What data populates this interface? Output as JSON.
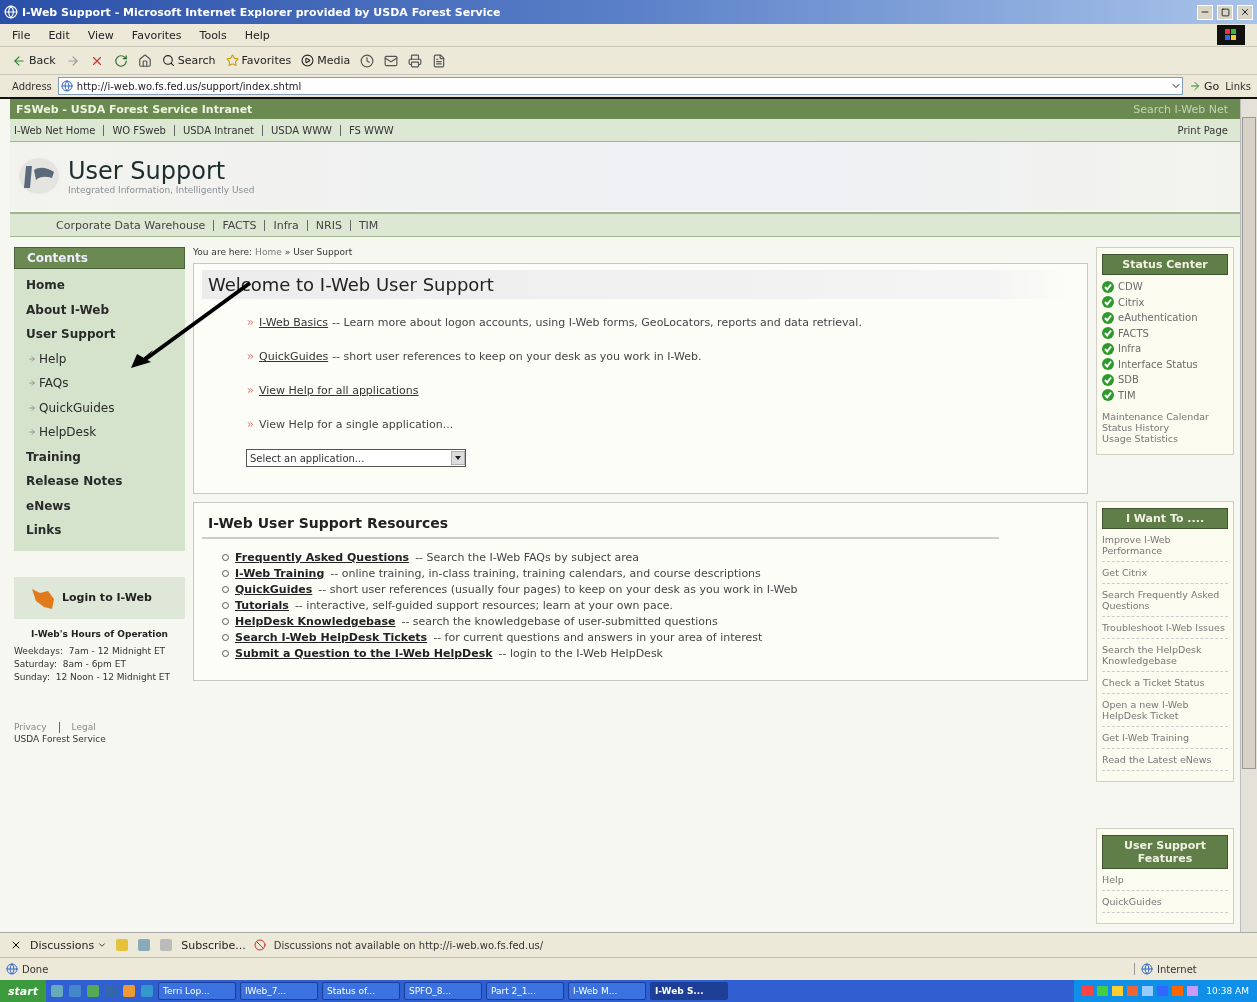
{
  "window": {
    "title": "I-Web Support - Microsoft Internet Explorer provided by USDA Forest Service"
  },
  "menu": [
    "File",
    "Edit",
    "View",
    "Favorites",
    "Tools",
    "Help"
  ],
  "toolbar": {
    "back": "Back",
    "search": "Search",
    "favorites": "Favorites",
    "media": "Media"
  },
  "address": {
    "label": "Address",
    "url": "http://i-web.wo.fs.fed.us/support/index.shtml",
    "go": "Go",
    "links": "Links"
  },
  "site_header": {
    "title": "FSWeb - USDA Forest Service Intranet",
    "search": "Search I-Web Net"
  },
  "nav_links": [
    "I-Web Net Home",
    "WO FSweb",
    "USDA Intranet",
    "USDA WWW",
    "FS WWW"
  ],
  "print": "Print Page",
  "banner": {
    "title": "User Support",
    "subtitle": "Integrated Information, Intelligently Used"
  },
  "app_links": [
    "Corporate Data Warehouse",
    "FACTS",
    "Infra",
    "NRIS",
    "TIM"
  ],
  "sidebar": {
    "header": "Contents",
    "items": [
      {
        "label": "Home",
        "kind": "main"
      },
      {
        "label": "About I-Web",
        "kind": "main"
      },
      {
        "label": "User Support",
        "kind": "main"
      },
      {
        "label": "Help",
        "kind": "sub"
      },
      {
        "label": "FAQs",
        "kind": "sub"
      },
      {
        "label": "QuickGuides",
        "kind": "sub"
      },
      {
        "label": "HelpDesk",
        "kind": "sub"
      },
      {
        "label": "Training",
        "kind": "main"
      },
      {
        "label": "Release Notes",
        "kind": "main"
      },
      {
        "label": "eNews",
        "kind": "main"
      },
      {
        "label": "Links",
        "kind": "main"
      }
    ],
    "login": "Login to I-Web",
    "hours_title": "I-Web's Hours of Operation",
    "hours": [
      "Weekdays:  7am - 12 Midnight ET",
      "Saturday:  8am - 6pm ET",
      "Sunday:  12 Noon - 12 Midnight ET"
    ],
    "footer_links": [
      "Privacy",
      "Legal"
    ],
    "org": "USDA Forest Service"
  },
  "breadcrumb": {
    "prefix": "You are here:",
    "home": "Home",
    "separator": "»",
    "current": "User Support"
  },
  "welcome": {
    "title": "Welcome to I-Web User Support",
    "items": [
      {
        "kind": "link",
        "link": "I-Web Basics",
        "text": "-- Learn more about logon accounts, using I-Web forms, GeoLocators, reports and data retrieval."
      },
      {
        "kind": "link",
        "link": "QuickGuides",
        "text": "-- short user references to keep on your desk as you work in I-Web."
      },
      {
        "kind": "link",
        "link": "View Help for all applications"
      },
      {
        "kind": "plain",
        "text": "View Help for a single application..."
      }
    ],
    "select": "Select an application..."
  },
  "resources": {
    "title": "I-Web User Support Resources",
    "items": [
      {
        "link": "Frequently Asked Questions",
        "text": "-- Search the I-Web FAQs by subject area"
      },
      {
        "link": "I-Web Training",
        "text": "-- online training, in-class training, training calendars, and course descriptions"
      },
      {
        "link": "QuickGuides",
        "text": "-- short user references (usually four pages) to keep on your desk as you work in I-Web"
      },
      {
        "link": "Tutorials",
        "text": "-- interactive, self-guided support resources; learn at your own pace."
      },
      {
        "link": "HelpDesk Knowledgebase",
        "text": "-- search the knowledgebase of user-submitted questions"
      },
      {
        "link": "Search I-Web HelpDesk Tickets",
        "text": "-- for current questions and answers in your area of interest"
      },
      {
        "link": "Submit a Question to the I-Web HelpDesk",
        "text": "-- login to the I-Web HelpDesk"
      }
    ]
  },
  "status_center": {
    "title": "Status Center",
    "services": [
      {
        "name": "CDW"
      },
      {
        "name": "Citrix"
      },
      {
        "name": "eAuthentication"
      },
      {
        "name": "FACTS"
      },
      {
        "name": "Infra"
      },
      {
        "name": "Interface Status"
      },
      {
        "name": "SDB"
      },
      {
        "name": "TIM"
      }
    ],
    "links": [
      "Maintenance Calendar",
      "Status History",
      "Usage Statistics"
    ]
  },
  "want_to": {
    "title": "I Want To ....",
    "items": [
      "Improve I-Web Performance",
      "Get Citrix",
      "Search Frequently Asked Questions",
      "Troubleshoot I-Web Issues",
      "Search the HelpDesk Knowledgebase",
      "Check a Ticket Status",
      "Open a new I-Web HelpDesk Ticket",
      "Get I-Web Training",
      "Read the Latest eNews"
    ]
  },
  "features": {
    "title": "User Support Features",
    "items": [
      "Help",
      "QuickGuides"
    ]
  },
  "discussions": {
    "label": "Discussions",
    "subscribe": "Subscribe...",
    "message": "Discussions not available on http://i-web.wo.fs.fed.us/"
  },
  "status_bar": {
    "text": "Done",
    "zone": "Internet"
  },
  "taskbar": {
    "start": "start",
    "tasks": [
      {
        "label": "Terri Lop...",
        "selected": false
      },
      {
        "label": "IWeb_7...",
        "selected": false
      },
      {
        "label": "Status of...",
        "selected": false
      },
      {
        "label": "SPFO_8...",
        "selected": false
      },
      {
        "label": "Part 2_1...",
        "selected": false
      },
      {
        "label": "I-Web M...",
        "selected": false
      },
      {
        "label": "I-Web S...",
        "selected": true
      }
    ],
    "clock": "10:38 AM"
  }
}
